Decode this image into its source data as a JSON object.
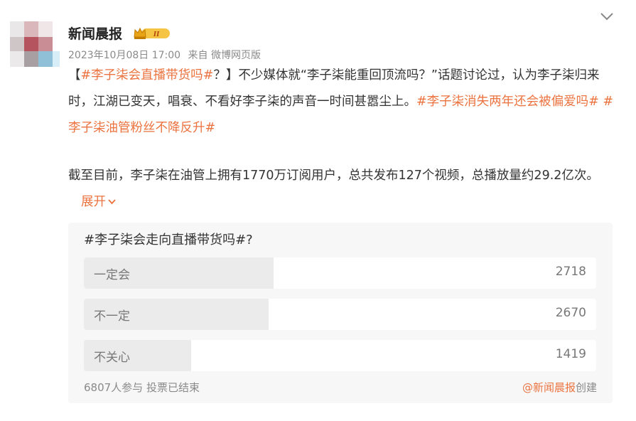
{
  "post": {
    "author": "新闻晨报",
    "badge_text": "II",
    "date": "2023年10月08日 17:00",
    "source": "来自 微博网页版",
    "paragraph1": [
      {
        "text": "【",
        "tag": false
      },
      {
        "text": "#李子柒会直播带货吗#",
        "tag": true
      },
      {
        "text": "？】不少媒体就“李子柒能重回顶流吗？”话题讨论过，认为李子柒归来时，江湖已变天，唱衰、不看好李子柒的声音一时间甚嚣尘上。",
        "tag": false
      },
      {
        "text": "#李子柒消失两年还会被偏爱吗#",
        "tag": true
      },
      {
        "text": " ",
        "tag": false
      },
      {
        "text": "#李子柒油管粉丝不降反升#",
        "tag": true
      }
    ],
    "paragraph2": "截至目前，李子柒在油管上拥有1770万订阅用户，总共发布127个视频，总播放量约29.2亿次。",
    "expand_label": "展开"
  },
  "poll": {
    "title": "#李子柒会走向直播带货吗#?",
    "options": [
      {
        "label": "一定会",
        "count": "2718",
        "share": 0.37
      },
      {
        "label": "不一定",
        "count": "2670",
        "share": 0.36
      },
      {
        "label": "不关心",
        "count": "1419",
        "share": 0.21
      }
    ],
    "participants": "6807人参与",
    "status": "投票已结束",
    "creator": "@新闻晨报",
    "creator_suffix": "创建"
  },
  "colors": {
    "accent": "#eb7340",
    "poll_bg": "#f7f7f7",
    "bar_fill": "#ebebeb"
  },
  "icons": {
    "collapse": "chevron-down-icon",
    "badge": "crown-icon"
  }
}
